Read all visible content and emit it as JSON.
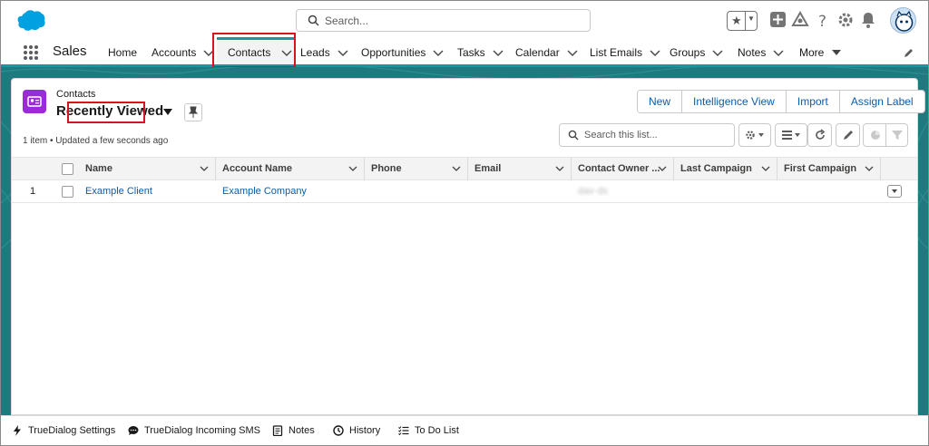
{
  "header": {
    "search_placeholder": "Search...",
    "brand_color": "#00a1e0"
  },
  "app_nav": {
    "app_name": "Sales",
    "items": [
      {
        "label": "Home"
      },
      {
        "label": "Accounts"
      },
      {
        "label": "Contacts"
      },
      {
        "label": "Leads"
      },
      {
        "label": "Opportunities"
      },
      {
        "label": "Tasks"
      },
      {
        "label": "Calendar"
      },
      {
        "label": "List Emails"
      },
      {
        "label": "Groups"
      },
      {
        "label": "Notes"
      },
      {
        "label": "More"
      }
    ],
    "active_item": "Contacts",
    "accent_color": "#1b96a0"
  },
  "list_view": {
    "object_label": "Contacts",
    "title": "Recently Viewed",
    "meta": "1 item • Updated a few seconds ago",
    "actions": [
      "New",
      "Intelligence View",
      "Import",
      "Assign Label"
    ],
    "search_placeholder": "Search this list..."
  },
  "table": {
    "columns": [
      "Name",
      "Account Name",
      "Phone",
      "Email",
      "Contact Owner ...",
      "Last Campaign",
      "First Campaign"
    ],
    "rows": [
      {
        "num": "1",
        "name": "Example Client",
        "account": "Example Company",
        "phone": "",
        "email": "",
        "owner": "dav·ds",
        "last_campaign": "",
        "first_campaign": ""
      }
    ]
  },
  "utility_bar": {
    "items": [
      "TrueDialog Settings",
      "TrueDialog Incoming SMS",
      "Notes",
      "History",
      "To Do List"
    ]
  },
  "colors": {
    "link": "#0b5cab",
    "highlight": "#d5141b",
    "contacts_icon": "#9a2bd8"
  }
}
